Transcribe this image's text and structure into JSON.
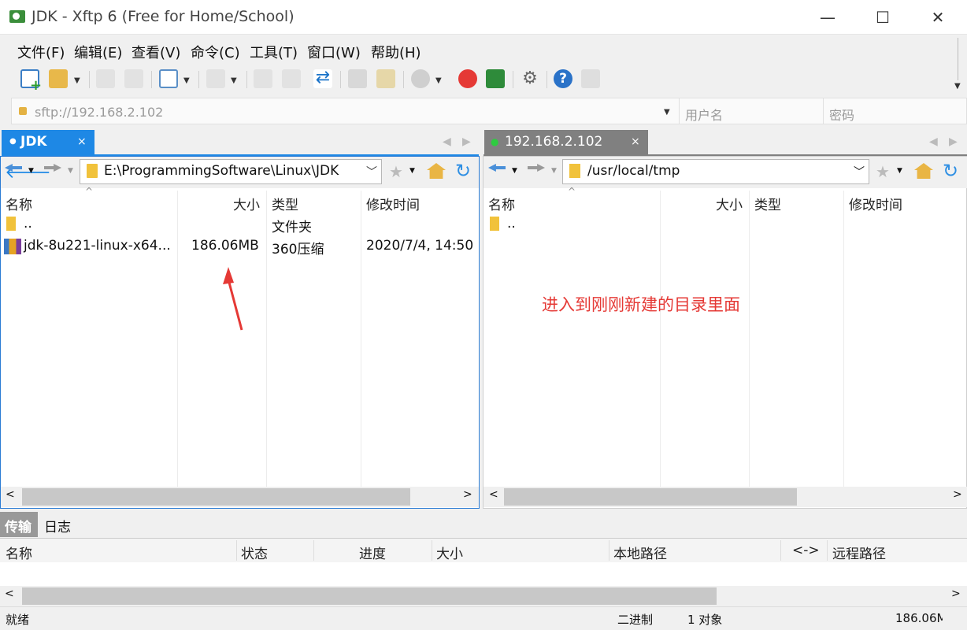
{
  "window": {
    "title": "JDK - Xftp 6 (Free for Home/School)"
  },
  "window_controls": {
    "minimize": "—",
    "maximize": "☐",
    "close": "✕"
  },
  "menu": [
    "文件(F)",
    "编辑(E)",
    "查看(V)",
    "命令(C)",
    "工具(T)",
    "窗口(W)",
    "帮助(H)"
  ],
  "address": {
    "url": "sftp://192.168.2.102",
    "username_placeholder": "用户名",
    "password_placeholder": "密码"
  },
  "tabs": {
    "left": {
      "label": "JDK",
      "close": "×"
    },
    "right": {
      "label": "192.168.2.102",
      "close": "×"
    }
  },
  "local_pane": {
    "path": "E:\\ProgrammingSoftware\\Linux\\JDK",
    "columns": [
      "名称",
      "大小",
      "类型",
      "修改时间"
    ],
    "rows": [
      {
        "name": "..",
        "size": "",
        "type": "文件夹",
        "modified": ""
      },
      {
        "name": "jdk-8u221-linux-x64...",
        "size": "186.06MB",
        "type": "360压缩",
        "modified": "2020/7/4, 14:50"
      }
    ]
  },
  "remote_pane": {
    "path": "/usr/local/tmp",
    "columns": [
      "名称",
      "大小",
      "类型",
      "修改时间"
    ],
    "rows": [
      {
        "name": "..",
        "size": "",
        "type": "",
        "modified": ""
      }
    ],
    "annotation": "进入到刚刚新建的目录里面"
  },
  "bottom_tabs": [
    "传输",
    "日志"
  ],
  "transfer_columns": [
    "名称",
    "状态",
    "进度",
    "大小",
    "本地路径",
    "<->",
    "远程路径"
  ],
  "status": {
    "ready": "就绪",
    "mode": "二进制",
    "objects": "1 对象",
    "size": "186.06M"
  },
  "colors": {
    "accent": "#1e88e5",
    "tab_active": "#1e88e5",
    "annotation": "#e53935",
    "connected": "#2ecc40"
  }
}
